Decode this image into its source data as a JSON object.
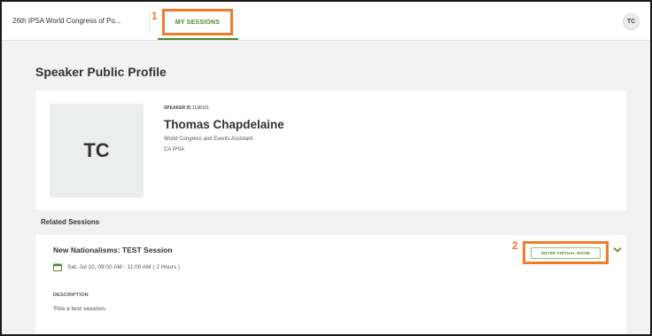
{
  "header": {
    "app_title": "26th IPSA World Congress of Po...",
    "tab_label": "MY SESSIONS",
    "avatar_initials": "TC",
    "step_marker_1": "1",
    "accent_color": "#4a8a24",
    "highlight_color": "#f07b2a"
  },
  "page": {
    "title": "Speaker Public Profile"
  },
  "profile": {
    "photo_initials": "TC",
    "speaker_id_label": "SPEAKER ID",
    "speaker_id_value": "1198101",
    "name": "Thomas Chapdelaine",
    "role": "World Congress and Events Assistant",
    "organization": "CA IPSA"
  },
  "related": {
    "title": "Related Sessions",
    "sessions": [
      {
        "title": "New Nationalisms: TEST Session",
        "datetime": "Sat, Jul 10, 09:00 AM - 11:00 AM ( 2 Hours )",
        "enter_label": "ENTER VIRTUAL ROOM",
        "step_marker": "2",
        "description_label": "DESCRIPTION",
        "description": "This a test session."
      }
    ]
  }
}
